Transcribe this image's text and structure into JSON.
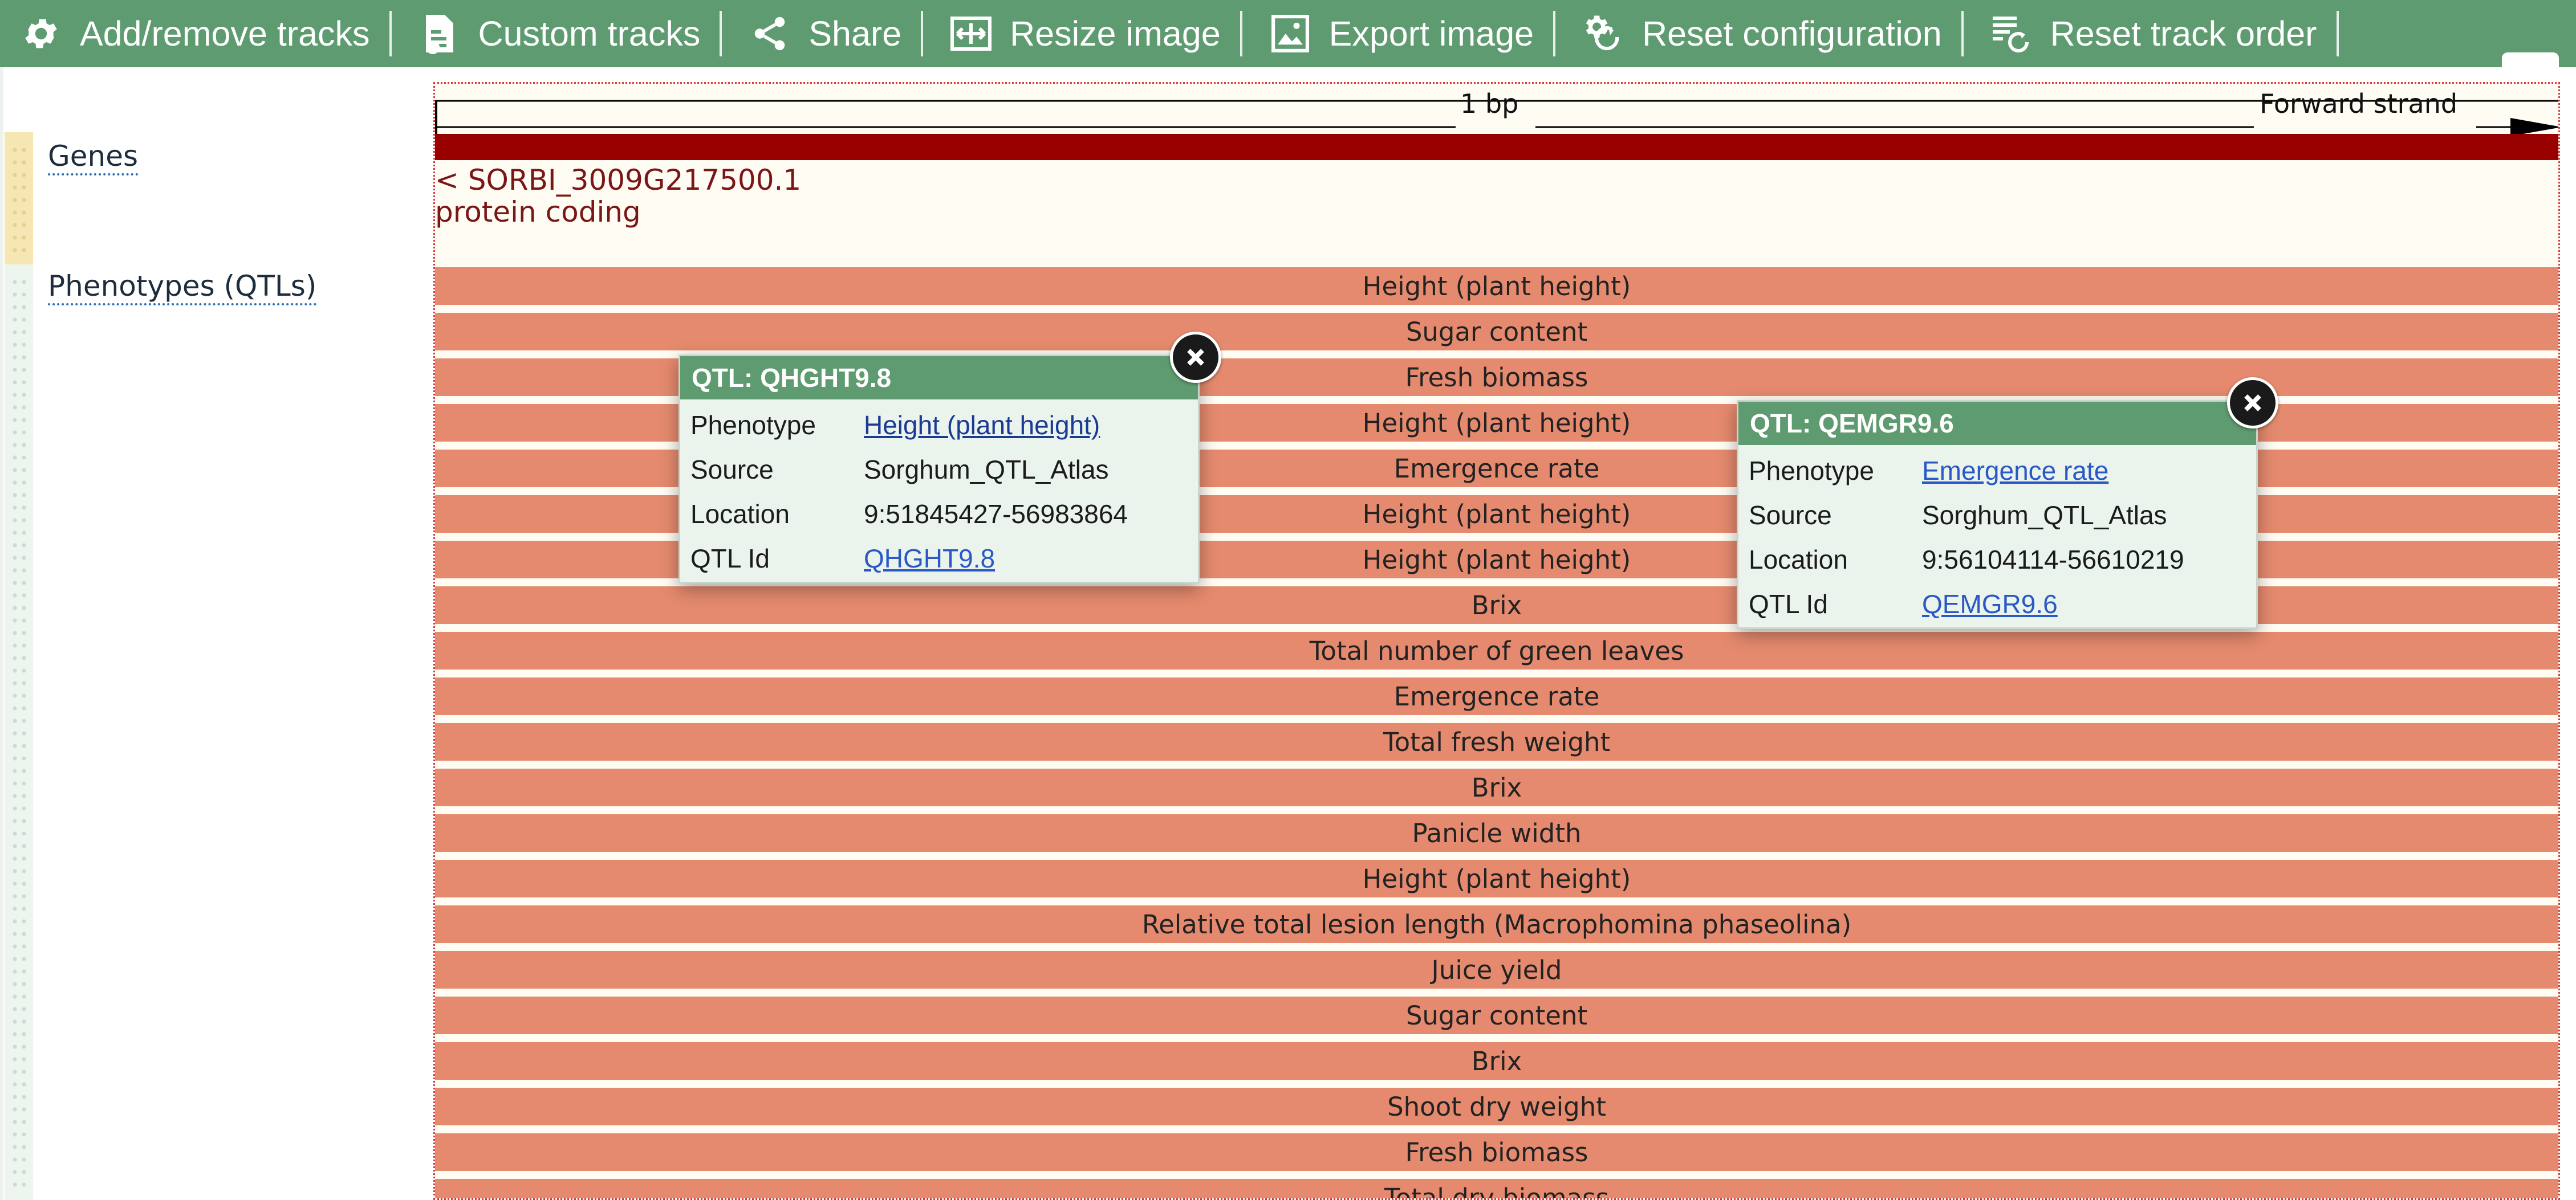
{
  "toolbar": {
    "items": [
      {
        "label": "Add/remove tracks",
        "icon": "gear-icon"
      },
      {
        "label": "Custom tracks",
        "icon": "custom-tracks-icon"
      },
      {
        "label": "Share",
        "icon": "share-icon"
      },
      {
        "label": "Resize image",
        "icon": "resize-icon"
      },
      {
        "label": "Export image",
        "icon": "export-image-icon"
      },
      {
        "label": "Reset configuration",
        "icon": "reset-configuration-icon"
      },
      {
        "label": "Reset track order",
        "icon": "reset-track-order-icon"
      }
    ],
    "color": "#5f9b70"
  },
  "tracks": {
    "genes_label": "Genes",
    "qtl_label": "Phenotypes (QTLs)"
  },
  "ruler": {
    "scale_label": "1 bp",
    "strand_label": "Forward strand"
  },
  "gene": {
    "name": "< SORBI_3009G217500.1",
    "biotype": "protein coding",
    "color": "#990000"
  },
  "qtl_rows": [
    "Height (plant height)",
    "Sugar content",
    "Fresh biomass",
    "Height (plant height)",
    "Emergence rate",
    "Height (plant height)",
    "Height (plant height)",
    "Brix",
    "Total number of green leaves",
    "Emergence rate",
    "Total fresh weight",
    "Brix",
    "Panicle width",
    "Height (plant height)",
    "Relative total lesion length (Macrophomina phaseolina)",
    "Juice yield",
    "Sugar content",
    "Brix",
    "Shoot dry weight",
    "Fresh biomass",
    "Total dry biomass"
  ],
  "qtl_color": "#e58a6e",
  "popups": [
    {
      "title": "QTL: QHGHT9.8",
      "phenotype_key": "Phenotype",
      "phenotype": "Height (plant height)",
      "source_key": "Source",
      "source": "Sorghum_QTL_Atlas",
      "location_key": "Location",
      "location": "9:51845427-56983864",
      "qtlid_key": "QTL Id",
      "qtlid": "QHGHT9.8"
    },
    {
      "title": "QTL: QEMGR9.6",
      "phenotype_key": "Phenotype",
      "phenotype": "Emergence rate",
      "source_key": "Source",
      "source": "Sorghum_QTL_Atlas",
      "location_key": "Location",
      "location": "9:56104114-56610219",
      "qtlid_key": "QTL Id",
      "qtlid": "QEMGR9.6"
    }
  ]
}
